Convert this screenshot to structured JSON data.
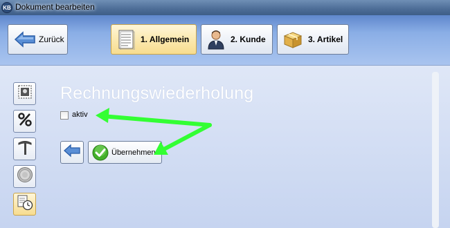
{
  "window": {
    "title": "Dokument bearbeiten",
    "app_icon": "KB"
  },
  "toolbar": {
    "back_label": "Zurück",
    "tabs": [
      {
        "label": "1. Allgemein",
        "icon": "document-icon",
        "active": true
      },
      {
        "label": "2. Kunde",
        "icon": "person-icon",
        "active": false
      },
      {
        "label": "3. Artikel",
        "icon": "box-icon",
        "active": false
      }
    ]
  },
  "sidebar": [
    {
      "icon": "stamp-icon",
      "active": false
    },
    {
      "icon": "percent-icon",
      "active": false
    },
    {
      "icon": "signpost-icon",
      "active": false
    },
    {
      "icon": "coin-icon",
      "active": false
    },
    {
      "icon": "clock-document-icon",
      "active": true
    }
  ],
  "main": {
    "heading": "Rechnungswiederholung",
    "checkbox": {
      "label": "aktiv",
      "checked": false
    },
    "apply_label": "Übernehmen"
  },
  "colors": {
    "accent_arrow": "#33ff33",
    "toolbar": "#7fa3e0",
    "active_tab": "#fbe9b0"
  }
}
